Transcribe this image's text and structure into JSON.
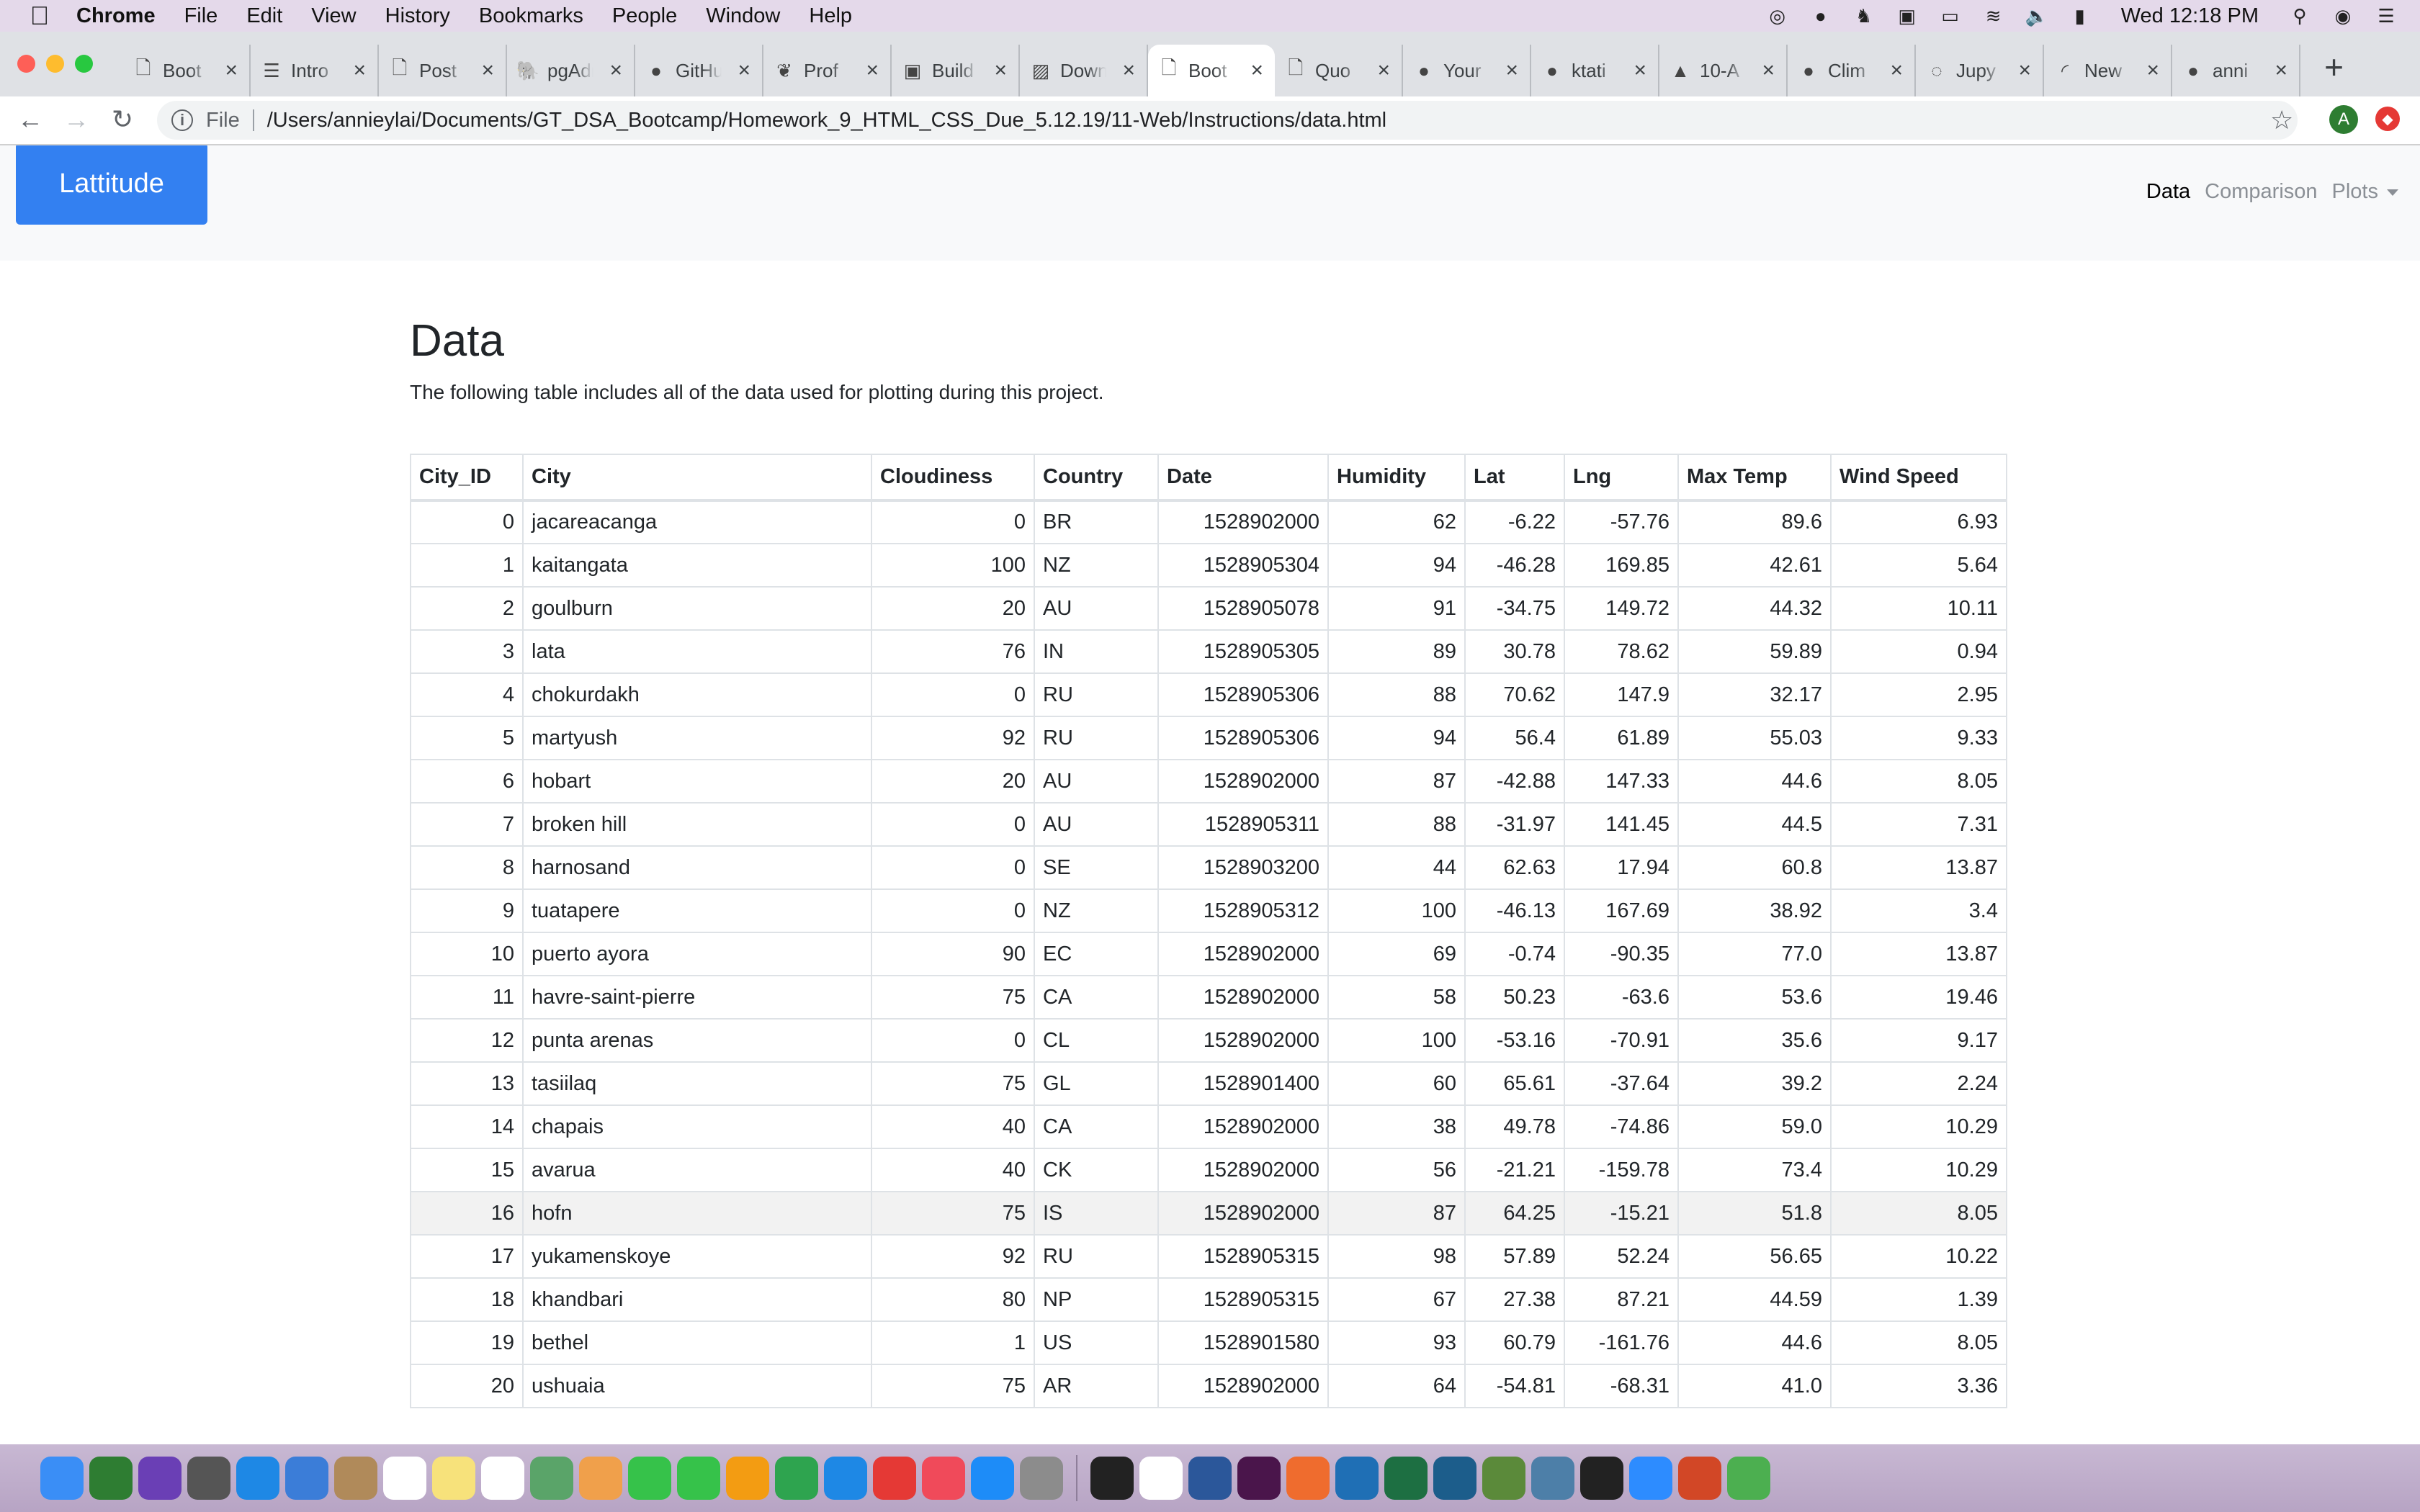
{
  "menubar": {
    "app": "Chrome",
    "items": [
      "File",
      "Edit",
      "View",
      "History",
      "Bookmarks",
      "People",
      "Window",
      "Help"
    ],
    "clock": "Wed 12:18 PM",
    "status_icons": [
      "creative-cloud-icon",
      "screen-record-icon",
      "evernote-icon",
      "wd-drive-icon",
      "airplay-icon",
      "wifi-icon",
      "volume-icon",
      "battery-icon"
    ]
  },
  "tabs": [
    {
      "title": "Boot",
      "icon": "page-icon"
    },
    {
      "title": "Intro",
      "icon": "doc-icon"
    },
    {
      "title": "Post",
      "icon": "page-icon"
    },
    {
      "title": "pgAdmin",
      "icon": "postgres-icon"
    },
    {
      "title": "GitHub",
      "icon": "github-icon"
    },
    {
      "title": "Prof",
      "icon": "leaf-icon"
    },
    {
      "title": "Build",
      "icon": "app-icon"
    },
    {
      "title": "Down",
      "icon": "chart-icon"
    },
    {
      "title": "Boot",
      "icon": "page-icon",
      "active": true
    },
    {
      "title": "Quo",
      "icon": "page-icon"
    },
    {
      "title": "Your",
      "icon": "github-icon"
    },
    {
      "title": "ktati",
      "icon": "github-icon"
    },
    {
      "title": "10-A",
      "icon": "gitlab-icon"
    },
    {
      "title": "Clim",
      "icon": "github-icon"
    },
    {
      "title": "Jupy",
      "icon": "jupyter-icon"
    },
    {
      "title": "New",
      "icon": "loading-icon"
    },
    {
      "title": "anni",
      "icon": "github-icon"
    }
  ],
  "toolbar": {
    "scheme": "File",
    "url": "/Users/annieylai/Documents/GT_DSA_Bootcamp/Homework_9_HTML_CSS_Due_5.12.19/11-Web/Instructions/data.html",
    "profile_initial": "A"
  },
  "navbar": {
    "brand": "Lattitude",
    "links": [
      "Data",
      "Comparison",
      "Plots"
    ]
  },
  "page": {
    "title": "Data",
    "description": "The following table includes all of the data used for plotting during this project."
  },
  "table": {
    "headers": [
      "City_ID",
      "City",
      "Cloudiness",
      "Country",
      "Date",
      "Humidity",
      "Lat",
      "Lng",
      "Max Temp",
      "Wind Speed"
    ],
    "rows": [
      [
        "0",
        "jacareacanga",
        "0",
        "BR",
        "1528902000",
        "62",
        "-6.22",
        "-57.76",
        "89.6",
        "6.93"
      ],
      [
        "1",
        "kaitangata",
        "100",
        "NZ",
        "1528905304",
        "94",
        "-46.28",
        "169.85",
        "42.61",
        "5.64"
      ],
      [
        "2",
        "goulburn",
        "20",
        "AU",
        "1528905078",
        "91",
        "-34.75",
        "149.72",
        "44.32",
        "10.11"
      ],
      [
        "3",
        "lata",
        "76",
        "IN",
        "1528905305",
        "89",
        "30.78",
        "78.62",
        "59.89",
        "0.94"
      ],
      [
        "4",
        "chokurdakh",
        "0",
        "RU",
        "1528905306",
        "88",
        "70.62",
        "147.9",
        "32.17",
        "2.95"
      ],
      [
        "5",
        "martyush",
        "92",
        "RU",
        "1528905306",
        "94",
        "56.4",
        "61.89",
        "55.03",
        "9.33"
      ],
      [
        "6",
        "hobart",
        "20",
        "AU",
        "1528902000",
        "87",
        "-42.88",
        "147.33",
        "44.6",
        "8.05"
      ],
      [
        "7",
        "broken hill",
        "0",
        "AU",
        "1528905311",
        "88",
        "-31.97",
        "141.45",
        "44.5",
        "7.31"
      ],
      [
        "8",
        "harnosand",
        "0",
        "SE",
        "1528903200",
        "44",
        "62.63",
        "17.94",
        "60.8",
        "13.87"
      ],
      [
        "9",
        "tuatapere",
        "0",
        "NZ",
        "1528905312",
        "100",
        "-46.13",
        "167.69",
        "38.92",
        "3.4"
      ],
      [
        "10",
        "puerto ayora",
        "90",
        "EC",
        "1528902000",
        "69",
        "-0.74",
        "-90.35",
        "77.0",
        "13.87"
      ],
      [
        "11",
        "havre-saint-pierre",
        "75",
        "CA",
        "1528902000",
        "58",
        "50.23",
        "-63.6",
        "53.6",
        "19.46"
      ],
      [
        "12",
        "punta arenas",
        "0",
        "CL",
        "1528902000",
        "100",
        "-53.16",
        "-70.91",
        "35.6",
        "9.17"
      ],
      [
        "13",
        "tasiilaq",
        "75",
        "GL",
        "1528901400",
        "60",
        "65.61",
        "-37.64",
        "39.2",
        "2.24"
      ],
      [
        "14",
        "chapais",
        "40",
        "CA",
        "1528902000",
        "38",
        "49.78",
        "-74.86",
        "59.0",
        "10.29"
      ],
      [
        "15",
        "avarua",
        "40",
        "CK",
        "1528902000",
        "56",
        "-21.21",
        "-159.78",
        "73.4",
        "10.29"
      ],
      [
        "16",
        "hofn",
        "75",
        "IS",
        "1528902000",
        "87",
        "64.25",
        "-15.21",
        "51.8",
        "8.05"
      ],
      [
        "17",
        "yukamenskoye",
        "92",
        "RU",
        "1528905315",
        "98",
        "57.89",
        "52.24",
        "56.65",
        "10.22"
      ],
      [
        "18",
        "khandbari",
        "80",
        "NP",
        "1528905315",
        "67",
        "27.38",
        "87.21",
        "44.59",
        "1.39"
      ],
      [
        "19",
        "bethel",
        "1",
        "US",
        "1528901580",
        "93",
        "60.79",
        "-161.76",
        "44.6",
        "8.05"
      ],
      [
        "20",
        "ushuaia",
        "75",
        "AR",
        "1528902000",
        "64",
        "-54.81",
        "-68.31",
        "41.0",
        "3.36"
      ]
    ],
    "highlighted_row": 16
  },
  "dock": {
    "apps": [
      "finder",
      "mission-control",
      "siri",
      "launchpad",
      "safari",
      "preview",
      "contacts",
      "calendar",
      "notes",
      "reminders",
      "maps",
      "photos",
      "messages",
      "facetime",
      "pages",
      "numbers",
      "keynote",
      "news",
      "music",
      "app-store",
      "system-preferences",
      "terminal",
      "chrome",
      "word",
      "slack",
      "postman",
      "vscode",
      "excel",
      "mysql-workbench",
      "stack-1",
      "stack-2",
      "github-desktop",
      "zoom",
      "powerpoint",
      "sync"
    ],
    "colors": [
      "#3a8ef6",
      "#2e7d32",
      "#6a3fb5",
      "#555",
      "#1e88e5",
      "#3b7dd8",
      "#b08a5a",
      "#ffffff",
      "#f7e27b",
      "#ffffff",
      "#5aa469",
      "#f0a04b",
      "#36c24a",
      "#36c24a",
      "#f39c12",
      "#2ea44f",
      "#1e88e5",
      "#e53935",
      "#f04a5a",
      "#1d8cf8",
      "#8c8c8c",
      "#222",
      "#ffffff",
      "#2b579a",
      "#4a154b",
      "#ef6c2e",
      "#1f6fb5",
      "#1d6f42",
      "#1c5d8b",
      "#5b8a3a",
      "#4d7fa8",
      "#222",
      "#2d8cff",
      "#d24726",
      "#4caf50"
    ]
  }
}
